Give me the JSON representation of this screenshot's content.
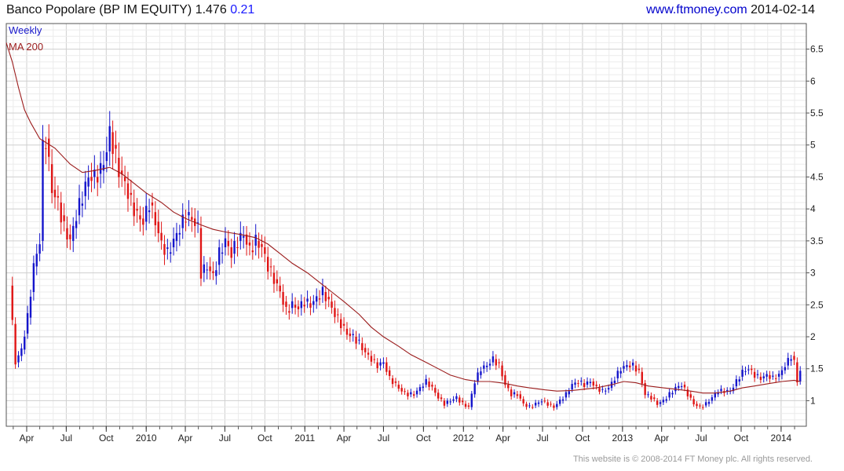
{
  "header": {
    "title": "Banco Popolare (BP IM EQUITY) 1.476",
    "change": "0.21",
    "source_url": "www.ftmoney.com",
    "date": "2014-02-14"
  },
  "footer": {
    "copyright": "This website is © 2008-2014 FT Money plc. All rights reserved."
  },
  "colors": {
    "up": "#1515cc",
    "down": "#e01515",
    "ma": "#9b1c1c",
    "grid": "#dcdcdc"
  },
  "chart_data": {
    "type": "candlestick",
    "frequency": "Weekly",
    "legend": [
      "Weekly",
      "MA 200"
    ],
    "legend_placement": "top-left",
    "grid": true,
    "x_tick_labels": [
      "Apr",
      "Jul",
      "Oct",
      "2010",
      "Apr",
      "Jul",
      "Oct",
      "2011",
      "Apr",
      "Jul",
      "Oct",
      "2012",
      "Apr",
      "Jul",
      "Oct",
      "2013",
      "Apr",
      "Jul",
      "Oct",
      "2014"
    ],
    "y_tick_labels": [
      "1",
      "1.5",
      "2",
      "2.5",
      "3",
      "3.5",
      "4",
      "4.5",
      "5",
      "5.5",
      "6",
      "6.5"
    ],
    "ylim": [
      0.6,
      6.9
    ],
    "xlim": [
      "2009-02-13",
      "2014-02-28"
    ],
    "close_series": {
      "name": "Weekly",
      "points": [
        [
          "2009-02-20",
          2.8
        ],
        [
          "2009-03-06",
          1.6
        ],
        [
          "2009-03-20",
          1.8
        ],
        [
          "2009-04-03",
          2.3
        ],
        [
          "2009-04-17",
          3.1
        ],
        [
          "2009-05-01",
          3.5
        ],
        [
          "2009-05-08",
          4.95
        ],
        [
          "2009-05-15",
          5.1
        ],
        [
          "2009-05-29",
          4.3
        ],
        [
          "2009-06-12",
          4.1
        ],
        [
          "2009-06-26",
          3.7
        ],
        [
          "2009-07-10",
          3.5
        ],
        [
          "2009-07-24",
          3.9
        ],
        [
          "2009-08-07",
          4.2
        ],
        [
          "2009-08-21",
          4.5
        ],
        [
          "2009-09-04",
          4.5
        ],
        [
          "2009-09-18",
          4.6
        ],
        [
          "2009-10-02",
          4.9
        ],
        [
          "2009-10-09",
          5.2
        ],
        [
          "2009-10-16",
          5.0
        ],
        [
          "2009-10-30",
          4.6
        ],
        [
          "2009-11-13",
          4.4
        ],
        [
          "2009-11-27",
          4.1
        ],
        [
          "2009-12-11",
          3.9
        ],
        [
          "2009-12-25",
          3.8
        ],
        [
          "2010-01-08",
          4.1
        ],
        [
          "2010-01-22",
          3.8
        ],
        [
          "2010-02-05",
          3.45
        ],
        [
          "2010-02-19",
          3.3
        ],
        [
          "2010-03-05",
          3.5
        ],
        [
          "2010-03-19",
          3.7
        ],
        [
          "2010-04-02",
          3.9
        ],
        [
          "2010-04-16",
          3.85
        ],
        [
          "2010-04-30",
          3.7
        ],
        [
          "2010-05-07",
          3.0
        ],
        [
          "2010-05-21",
          3.1
        ],
        [
          "2010-06-04",
          2.95
        ],
        [
          "2010-06-18",
          3.3
        ],
        [
          "2010-07-02",
          3.5
        ],
        [
          "2010-07-16",
          3.3
        ],
        [
          "2010-07-30",
          3.5
        ],
        [
          "2010-08-13",
          3.6
        ],
        [
          "2010-08-27",
          3.35
        ],
        [
          "2010-09-10",
          3.5
        ],
        [
          "2010-09-24",
          3.4
        ],
        [
          "2010-10-08",
          3.1
        ],
        [
          "2010-10-22",
          2.9
        ],
        [
          "2010-11-05",
          2.7
        ],
        [
          "2010-11-19",
          2.4
        ],
        [
          "2010-12-03",
          2.5
        ],
        [
          "2010-12-17",
          2.45
        ],
        [
          "2010-12-31",
          2.55
        ],
        [
          "2011-01-14",
          2.5
        ],
        [
          "2011-01-28",
          2.6
        ],
        [
          "2011-02-11",
          2.7
        ],
        [
          "2011-02-25",
          2.55
        ],
        [
          "2011-03-11",
          2.35
        ],
        [
          "2011-03-25",
          2.2
        ],
        [
          "2011-04-08",
          2.05
        ],
        [
          "2011-04-22",
          2.0
        ],
        [
          "2011-05-06",
          1.9
        ],
        [
          "2011-05-20",
          1.75
        ],
        [
          "2011-06-03",
          1.65
        ],
        [
          "2011-06-17",
          1.55
        ],
        [
          "2011-07-01",
          1.6
        ],
        [
          "2011-07-15",
          1.35
        ],
        [
          "2011-07-29",
          1.25
        ],
        [
          "2011-08-12",
          1.15
        ],
        [
          "2011-08-26",
          1.1
        ],
        [
          "2011-09-09",
          1.1
        ],
        [
          "2011-09-23",
          1.2
        ],
        [
          "2011-10-07",
          1.3
        ],
        [
          "2011-10-21",
          1.2
        ],
        [
          "2011-11-04",
          1.05
        ],
        [
          "2011-11-18",
          0.95
        ],
        [
          "2011-12-02",
          1.0
        ],
        [
          "2011-12-16",
          1.05
        ],
        [
          "2011-12-30",
          0.95
        ],
        [
          "2012-01-13",
          0.9
        ],
        [
          "2012-01-27",
          1.3
        ],
        [
          "2012-02-10",
          1.5
        ],
        [
          "2012-02-24",
          1.55
        ],
        [
          "2012-03-09",
          1.65
        ],
        [
          "2012-03-23",
          1.55
        ],
        [
          "2012-04-06",
          1.25
        ],
        [
          "2012-04-20",
          1.1
        ],
        [
          "2012-05-04",
          1.1
        ],
        [
          "2012-05-18",
          0.95
        ],
        [
          "2012-06-01",
          0.9
        ],
        [
          "2012-06-15",
          0.95
        ],
        [
          "2012-06-29",
          1.0
        ],
        [
          "2012-07-13",
          0.95
        ],
        [
          "2012-07-27",
          0.9
        ],
        [
          "2012-08-10",
          1.0
        ],
        [
          "2012-08-24",
          1.1
        ],
        [
          "2012-09-07",
          1.25
        ],
        [
          "2012-09-21",
          1.3
        ],
        [
          "2012-10-05",
          1.25
        ],
        [
          "2012-10-19",
          1.3
        ],
        [
          "2012-11-02",
          1.2
        ],
        [
          "2012-11-16",
          1.15
        ],
        [
          "2012-11-30",
          1.2
        ],
        [
          "2012-12-14",
          1.35
        ],
        [
          "2012-12-28",
          1.5
        ],
        [
          "2013-01-11",
          1.55
        ],
        [
          "2013-01-25",
          1.55
        ],
        [
          "2013-02-08",
          1.45
        ],
        [
          "2013-02-22",
          1.1
        ],
        [
          "2013-03-08",
          1.05
        ],
        [
          "2013-03-22",
          0.95
        ],
        [
          "2013-04-05",
          1.0
        ],
        [
          "2013-04-19",
          1.1
        ],
        [
          "2013-05-03",
          1.2
        ],
        [
          "2013-05-17",
          1.25
        ],
        [
          "2013-05-31",
          1.1
        ],
        [
          "2013-06-14",
          0.95
        ],
        [
          "2013-06-28",
          0.9
        ],
        [
          "2013-07-12",
          0.95
        ],
        [
          "2013-07-26",
          1.05
        ],
        [
          "2013-08-09",
          1.15
        ],
        [
          "2013-08-23",
          1.15
        ],
        [
          "2013-09-06",
          1.15
        ],
        [
          "2013-09-20",
          1.3
        ],
        [
          "2013-10-04",
          1.45
        ],
        [
          "2013-10-18",
          1.5
        ],
        [
          "2013-11-01",
          1.4
        ],
        [
          "2013-11-15",
          1.35
        ],
        [
          "2013-11-29",
          1.4
        ],
        [
          "2013-12-13",
          1.35
        ],
        [
          "2013-12-27",
          1.4
        ],
        [
          "2014-01-10",
          1.55
        ],
        [
          "2014-01-24",
          1.7
        ],
        [
          "2014-01-31",
          1.6
        ],
        [
          "2014-02-07",
          1.3
        ],
        [
          "2014-02-14",
          1.476
        ]
      ]
    },
    "ma_series": {
      "name": "MA 200",
      "points": [
        [
          "2009-02-13",
          6.6
        ],
        [
          "2009-02-27",
          6.3
        ],
        [
          "2009-03-13",
          5.9
        ],
        [
          "2009-03-27",
          5.55
        ],
        [
          "2009-04-10",
          5.35
        ],
        [
          "2009-05-01",
          5.1
        ],
        [
          "2009-06-05",
          4.95
        ],
        [
          "2009-07-10",
          4.7
        ],
        [
          "2009-08-07",
          4.57
        ],
        [
          "2009-09-04",
          4.6
        ],
        [
          "2009-10-09",
          4.65
        ],
        [
          "2009-11-06",
          4.55
        ],
        [
          "2009-12-04",
          4.4
        ],
        [
          "2010-01-01",
          4.25
        ],
        [
          "2010-02-05",
          4.1
        ],
        [
          "2010-03-05",
          3.95
        ],
        [
          "2010-04-02",
          3.85
        ],
        [
          "2010-05-07",
          3.75
        ],
        [
          "2010-06-04",
          3.68
        ],
        [
          "2010-07-02",
          3.64
        ],
        [
          "2010-08-06",
          3.6
        ],
        [
          "2010-09-10",
          3.55
        ],
        [
          "2010-10-08",
          3.45
        ],
        [
          "2010-11-05",
          3.3
        ],
        [
          "2010-12-03",
          3.15
        ],
        [
          "2011-01-07",
          3.0
        ],
        [
          "2011-02-04",
          2.85
        ],
        [
          "2011-03-04",
          2.7
        ],
        [
          "2011-04-01",
          2.55
        ],
        [
          "2011-05-06",
          2.35
        ],
        [
          "2011-06-03",
          2.15
        ],
        [
          "2011-07-01",
          2.0
        ],
        [
          "2011-08-05",
          1.85
        ],
        [
          "2011-09-02",
          1.72
        ],
        [
          "2011-10-07",
          1.6
        ],
        [
          "2011-11-04",
          1.5
        ],
        [
          "2011-12-02",
          1.4
        ],
        [
          "2012-01-06",
          1.33
        ],
        [
          "2012-02-03",
          1.3
        ],
        [
          "2012-03-02",
          1.3
        ],
        [
          "2012-04-06",
          1.27
        ],
        [
          "2012-05-04",
          1.23
        ],
        [
          "2012-06-01",
          1.2
        ],
        [
          "2012-07-06",
          1.17
        ],
        [
          "2012-08-03",
          1.15
        ],
        [
          "2012-09-07",
          1.16
        ],
        [
          "2012-10-05",
          1.18
        ],
        [
          "2012-11-02",
          1.2
        ],
        [
          "2012-12-07",
          1.25
        ],
        [
          "2013-01-04",
          1.3
        ],
        [
          "2013-02-01",
          1.28
        ],
        [
          "2013-03-01",
          1.23
        ],
        [
          "2013-04-05",
          1.2
        ],
        [
          "2013-05-03",
          1.18
        ],
        [
          "2013-06-07",
          1.15
        ],
        [
          "2013-07-05",
          1.12
        ],
        [
          "2013-08-02",
          1.12
        ],
        [
          "2013-09-06",
          1.15
        ],
        [
          "2013-10-04",
          1.2
        ],
        [
          "2013-11-01",
          1.23
        ],
        [
          "2013-12-06",
          1.27
        ],
        [
          "2014-01-03",
          1.3
        ],
        [
          "2014-01-31",
          1.32
        ],
        [
          "2014-02-14",
          1.3
        ]
      ]
    }
  }
}
